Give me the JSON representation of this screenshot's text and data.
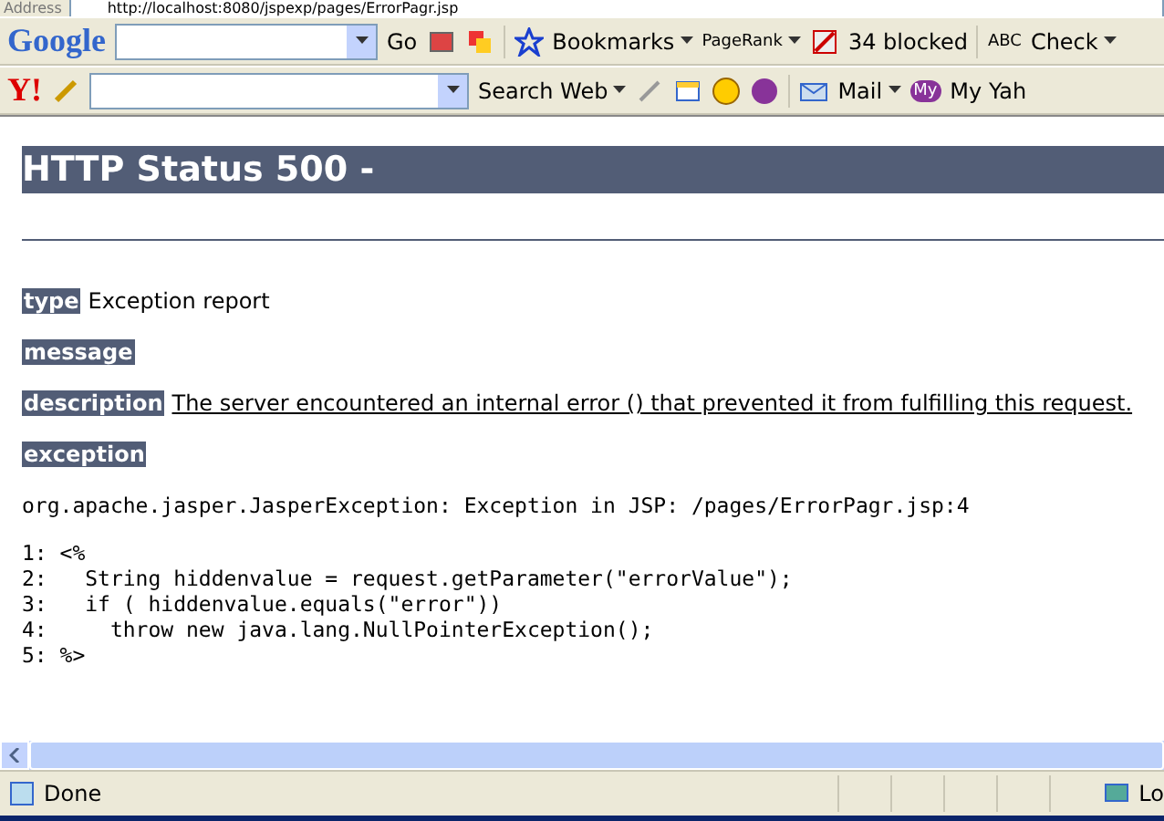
{
  "address_bar": {
    "label": "Address",
    "url": "http://localhost:8080/jspexp/pages/ErrorPagr.jsp"
  },
  "google_toolbar": {
    "logo": "Google",
    "go": "Go",
    "bookmarks": "Bookmarks",
    "pagerank": "PageRank",
    "blocked": "34 blocked",
    "check": "Check",
    "check_badge": "ABC"
  },
  "yahoo_toolbar": {
    "logo": "Y!",
    "search_button": "Search Web",
    "mail": "Mail",
    "my_yahoo": "My Yah",
    "my_badge": "My"
  },
  "page": {
    "heading": "HTTP Status 500 -",
    "sections": [
      {
        "label": "type",
        "text": "Exception report",
        "underlined": false
      },
      {
        "label": "message"
      },
      {
        "label": "description",
        "text": "The server encountered an internal error () that prevented it from fulfilling this request.",
        "underlined": true
      },
      {
        "label": "exception"
      }
    ],
    "exception_line": "org.apache.jasper.JasperException: Exception in JSP: /pages/ErrorPagr.jsp:4",
    "code_lines": [
      "1: <%",
      "2:   String hiddenvalue = request.getParameter(\"errorValue\");",
      "3:   if ( hiddenvalue.equals(\"error\"))",
      "4:     throw new java.lang.NullPointerException();",
      "5: %>"
    ]
  },
  "status_bar": {
    "text": "Done",
    "zone": "Lo"
  }
}
